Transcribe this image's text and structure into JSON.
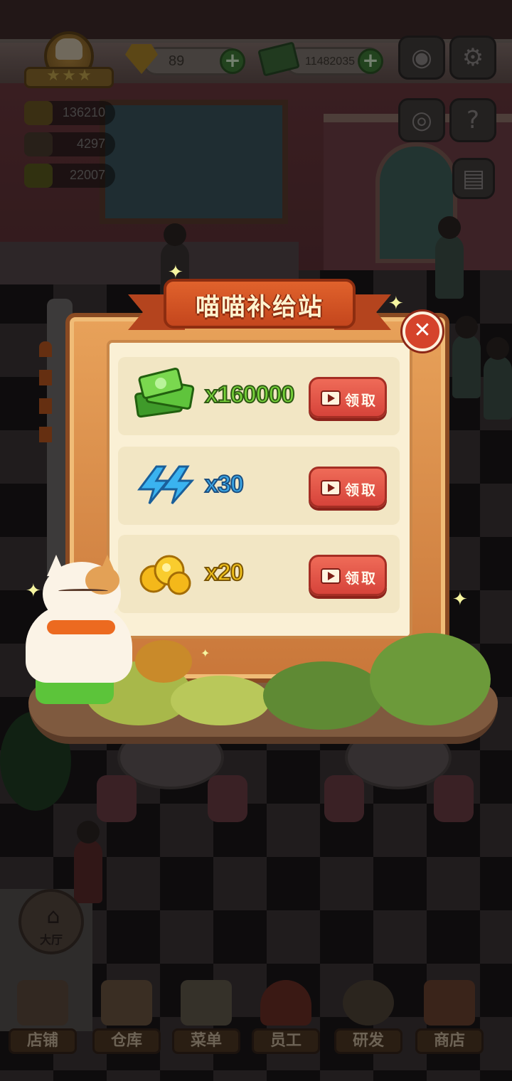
{
  "hud": {
    "gems": "89",
    "cash": "11482035",
    "stats": [
      "136210",
      "4297",
      "22007"
    ]
  },
  "popup": {
    "title": "喵喵补给站",
    "close_icon": "close-icon",
    "rewards": [
      {
        "icon": "cash-stack-icon",
        "amount": "x160000",
        "color": "#78d43a",
        "claim_label": "领取"
      },
      {
        "icon": "lightning-energy-icon",
        "amount": "x30",
        "color": "#3aa6e6",
        "claim_label": "领取"
      },
      {
        "icon": "gold-nugget-icon",
        "amount": "x20",
        "color": "#f2c21a",
        "claim_label": "领取"
      }
    ]
  },
  "hall_button": {
    "label": "大厅"
  },
  "nav": [
    {
      "label": "店铺",
      "icon": "shop-building-icon"
    },
    {
      "label": "仓库",
      "icon": "warehouse-boxes-icon"
    },
    {
      "label": "菜单",
      "icon": "menu-clipboard-icon"
    },
    {
      "label": "员工",
      "icon": "staff-chef-icon"
    },
    {
      "label": "研发",
      "icon": "research-pot-icon"
    },
    {
      "label": "商店",
      "icon": "store-stall-icon"
    }
  ]
}
